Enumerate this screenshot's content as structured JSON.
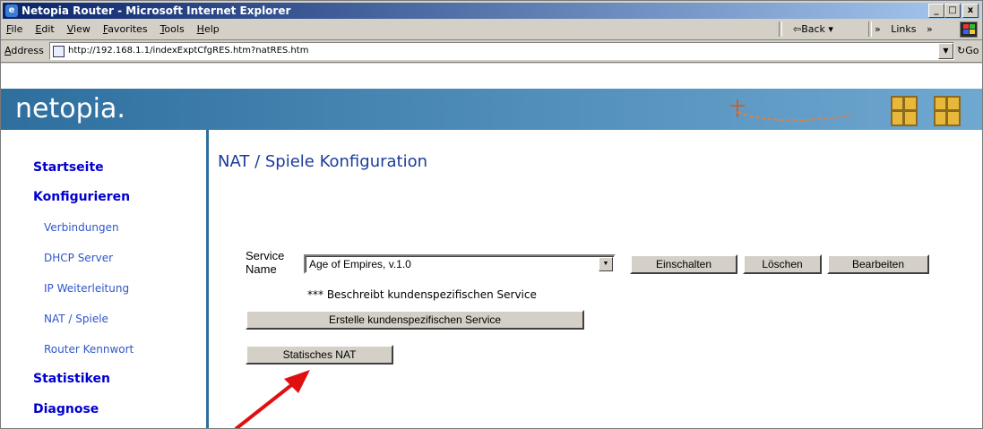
{
  "window": {
    "title": "Netopia Router - Microsoft Internet Explorer",
    "controls": {
      "minimize": "_",
      "maximize": "□",
      "close": "x"
    }
  },
  "menubar": {
    "items": [
      "File",
      "Edit",
      "View",
      "Favorites",
      "Tools",
      "Help"
    ],
    "back_label": "⇦Back ▾",
    "chevron": "»",
    "links_label": "Links"
  },
  "addressbar": {
    "label": "Address",
    "url": "http://192.168.1.1/indexExptCfgRES.htm?natRES.htm",
    "go_label": "Go"
  },
  "banner": {
    "logo": "netopia."
  },
  "sidebar": {
    "startseite": "Startseite",
    "konfigurieren": "Konfigurieren",
    "sub": [
      "Verbindungen",
      "DHCP Server",
      "IP Weiterleitung",
      "NAT / Spiele",
      "Router Kennwort"
    ],
    "statistiken": "Statistiken",
    "diagnose": "Diagnose"
  },
  "main": {
    "title": "NAT / Spiele Konfiguration",
    "service_label_1": "Service",
    "service_label_2": "Name",
    "service_selected": "Age of Empires, v.1.0",
    "btn_einschalten": "Einschalten",
    "btn_loeschen": "Löschen",
    "btn_bearbeiten": "Bearbeiten",
    "note": "*** Beschreibt kundenspezifischen Service",
    "btn_create": "Erstelle kundenspezifischen Service",
    "btn_static_nat": "Statisches NAT"
  },
  "colors": {
    "title_bar": "#0a246a",
    "banner": "#2e6f9e",
    "nav_link": "#0000cc",
    "arrow": "#e01010"
  }
}
